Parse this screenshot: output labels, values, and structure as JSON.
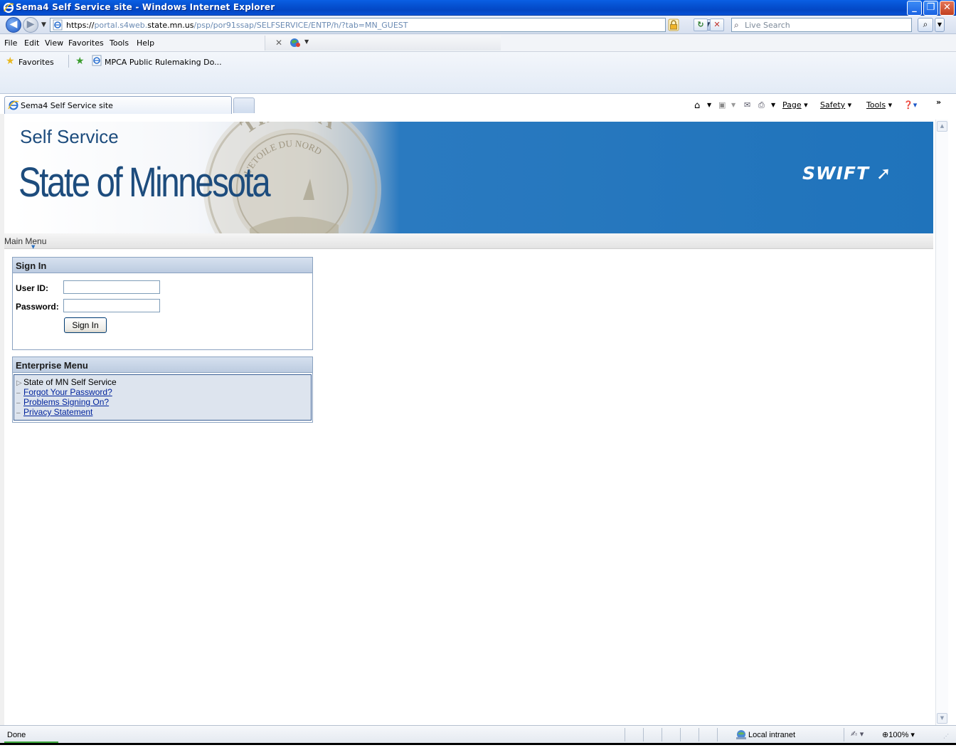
{
  "window": {
    "title": "Sema4 Self Service site - Windows Internet Explorer",
    "minimize": "_",
    "restore": "❐",
    "close": "✕"
  },
  "address": {
    "url_scheme": "https://",
    "url_host_pre": "portal.s4web.",
    "url_host_bold": "state.mn.us",
    "url_path": "/psp/por91ssap/SELFSERVICE/ENTP/h/?tab=MN_GUEST",
    "search_placeholder": "Live Search"
  },
  "menu": {
    "items": [
      {
        "label": "File"
      },
      {
        "label": "Edit"
      },
      {
        "label": "View"
      },
      {
        "label": "Favorites"
      },
      {
        "label": "Tools"
      },
      {
        "label": "Help"
      }
    ]
  },
  "favorites": {
    "label": "Favorites",
    "link": "MPCA Public Rulemaking Do..."
  },
  "tabs": {
    "active_label": "Sema4 Self Service site"
  },
  "commands": {
    "page": "Page",
    "safety": "Safety",
    "tools": "Tools"
  },
  "banner": {
    "small_title": "Self Service",
    "big_title": "State of Minnesota",
    "brand": "SWIFT",
    "seal_top": "THE STA",
    "seal_inner": "L'ETOILE DU NORD"
  },
  "main_menu": {
    "label": "Main Menu"
  },
  "sign_in": {
    "heading": "Sign In",
    "user_id_label": "User ID:",
    "password_label": "Password:",
    "user_id_value": "",
    "password_value": "",
    "button": "Sign In"
  },
  "enterprise_menu": {
    "heading": "Enterprise Menu",
    "folder": "State of MN Self Service",
    "links": [
      "Forgot Your Password?",
      "Problems Signing On?",
      "Privacy Statement"
    ]
  },
  "status": {
    "text": "Done",
    "zone": "Local intranet",
    "zoom": "100%"
  },
  "colors": {
    "titlebar": "#0550d0",
    "banner_blue": "#1f73bb",
    "banner_text": "#1d4c7d",
    "link": "#00239c"
  }
}
